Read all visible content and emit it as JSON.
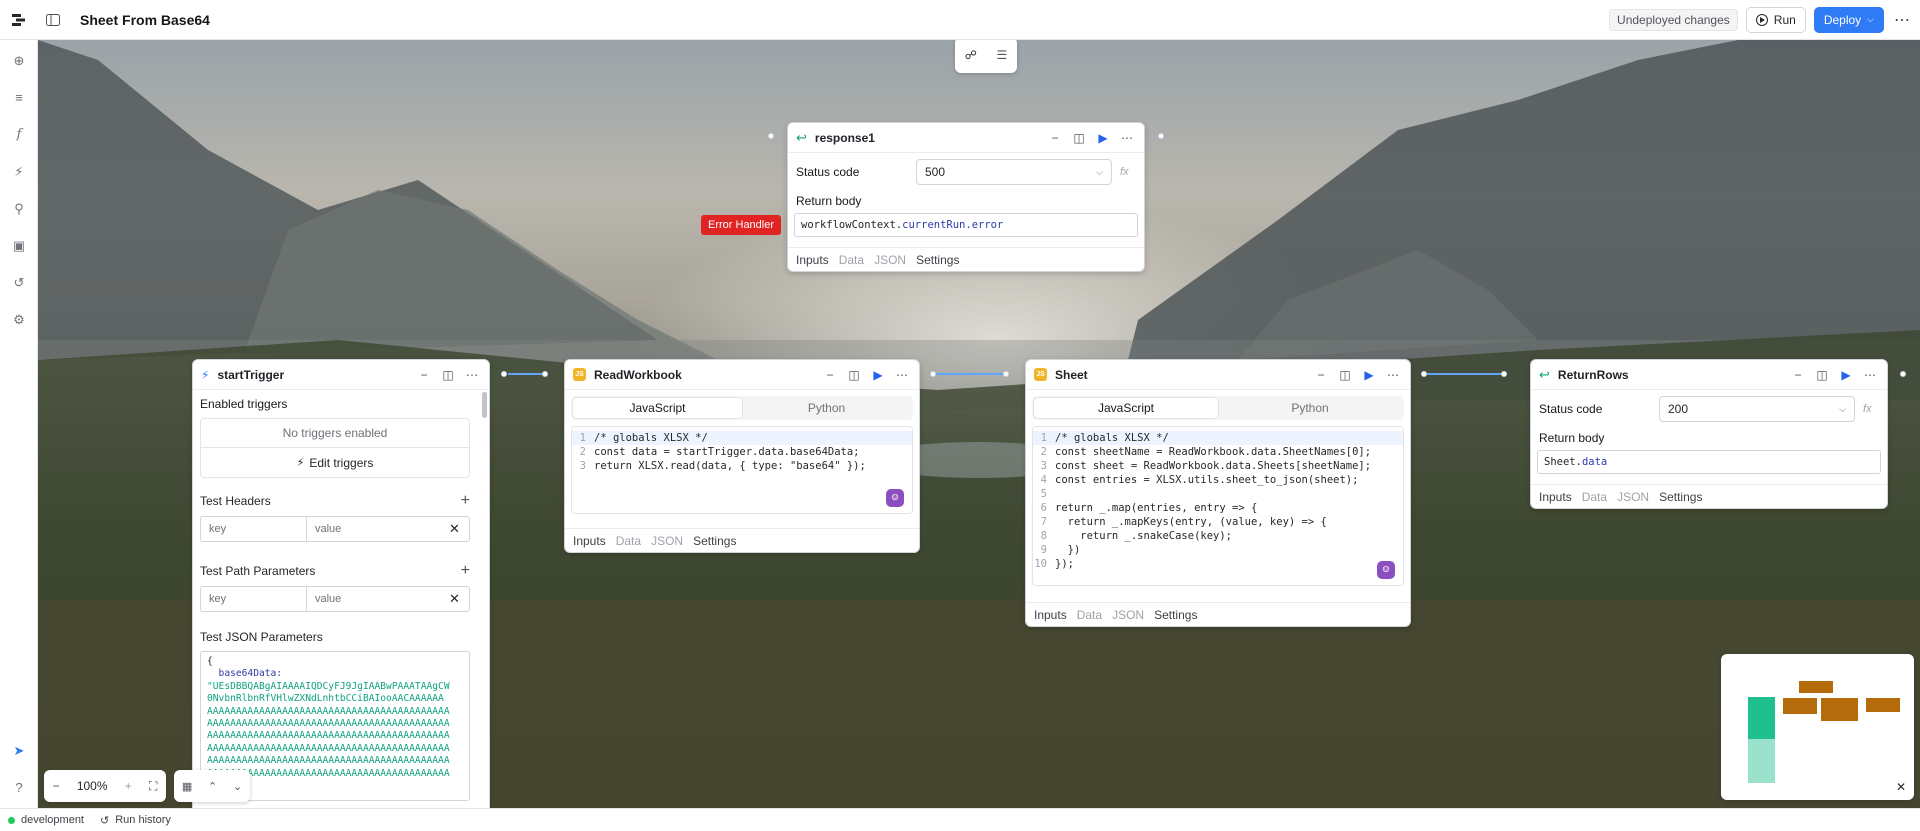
{
  "app": {
    "title": "Sheet From Base64",
    "status": "Undeployed changes",
    "run_label": "Run",
    "deploy_label": "Deploy"
  },
  "canvas_controls": {
    "zoom": "100%"
  },
  "statusbar": {
    "env": "development",
    "history": "Run history"
  },
  "error_badge": "Error Handler",
  "start_trigger": {
    "title": "startTrigger",
    "enabled_label": "Enabled triggers",
    "no_triggers": "No triggers enabled",
    "edit_triggers": "Edit triggers",
    "headers_label": "Test Headers",
    "path_label": "Test Path Parameters",
    "key_placeholder": "key",
    "value_placeholder": "value",
    "json_label": "Test JSON Parameters",
    "json_lines": [
      "{",
      "  base64Data:",
      "\"UEsDBBQABgAIAAAAIQDCyFJ9JgIAABwPAAATAAgCW",
      "0NvbnRlbnRfVHlwZXNdLnhtbCCiBAIooAACAAAAAA",
      "AAAAAAAAAAAAAAAAAAAAAAAAAAAAAAAAAAAAAAAAAA",
      "AAAAAAAAAAAAAAAAAAAAAAAAAAAAAAAAAAAAAAAAAA",
      "AAAAAAAAAAAAAAAAAAAAAAAAAAAAAAAAAAAAAAAAAA",
      "AAAAAAAAAAAAAAAAAAAAAAAAAAAAAAAAAAAAAAAAAA",
      "AAAAAAAAAAAAAAAAAAAAAAAAAAAAAAAAAAAAAAAAAA",
      "AAAAAAAAAAAAAAAAAAAAAAAAAAAAAAAAAAAAAAAAAA"
    ]
  },
  "response1": {
    "title": "response1",
    "status_label": "Status code",
    "status_value": "500",
    "body_label": "Return body",
    "body_prefix": "workflowContext.",
    "body_prop": "currentRun.error"
  },
  "read_workbook": {
    "title": "ReadWorkbook",
    "lang_js": "JavaScript",
    "lang_py": "Python",
    "code": [
      {
        "n": "1",
        "t": "/* globals XLSX */"
      },
      {
        "n": "2",
        "t": "const data = startTrigger.data.base64Data;"
      },
      {
        "n": "3",
        "t": "return XLSX.read(data, { type: \"base64\" });"
      }
    ]
  },
  "sheet": {
    "title": "Sheet",
    "lang_js": "JavaScript",
    "lang_py": "Python",
    "code": [
      {
        "n": "1",
        "t": "/* globals XLSX */"
      },
      {
        "n": "2",
        "t": "const sheetName = ReadWorkbook.data.SheetNames[0];"
      },
      {
        "n": "3",
        "t": "const sheet = ReadWorkbook.data.Sheets[sheetName];"
      },
      {
        "n": "4",
        "t": "const entries = XLSX.utils.sheet_to_json(sheet);"
      },
      {
        "n": "5",
        "t": ""
      },
      {
        "n": "6",
        "t": "return _.map(entries, entry => {"
      },
      {
        "n": "7",
        "t": "  return _.mapKeys(entry, (value, key) => {"
      },
      {
        "n": "8",
        "t": "    return _.snakeCase(key);"
      },
      {
        "n": "9",
        "t": "  })"
      },
      {
        "n": "10",
        "t": "});"
      }
    ]
  },
  "return_rows": {
    "title": "ReturnRows",
    "status_label": "Status code",
    "status_value": "200",
    "body_label": "Return body",
    "body_prefix": "Sheet.",
    "body_prop": "data"
  },
  "node_tabs": {
    "inputs": "Inputs",
    "data": "Data",
    "json": "JSON",
    "settings": "Settings"
  },
  "colors": {
    "accent": "#2f7bf5",
    "error": "#e02424",
    "connector": "#60a5fa",
    "minimap_green": "#1fbf8f",
    "minimap_brown": "#b36b0c"
  }
}
